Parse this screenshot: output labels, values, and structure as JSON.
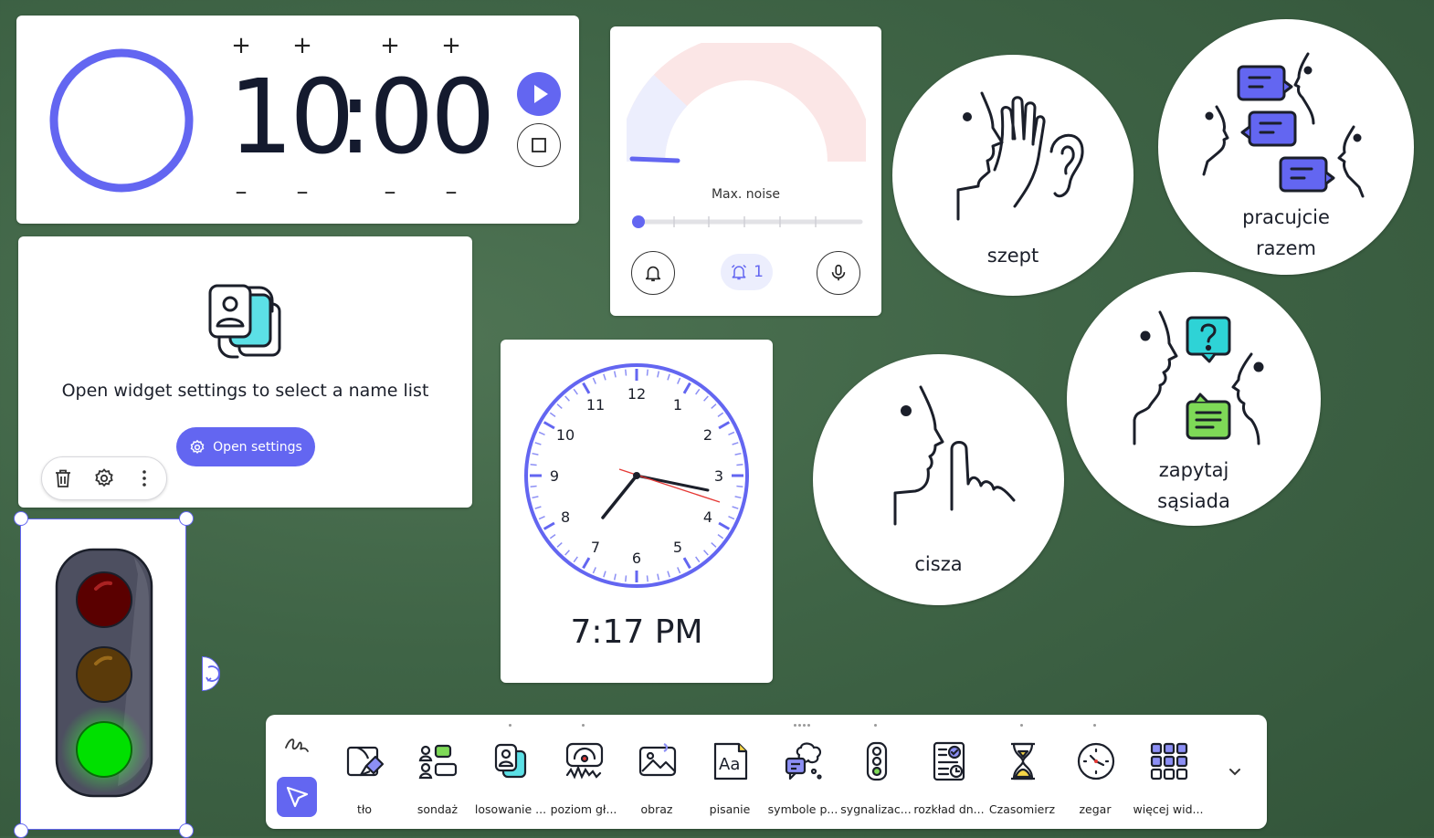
{
  "timer": {
    "minutes": "10",
    "sep": ":",
    "seconds": "00",
    "plus": "+",
    "minus": "–"
  },
  "noise": {
    "label": "Max. noise",
    "alert_count": "1",
    "colors": {
      "accent": "#6366f1",
      "arc_bg": "#fbe6e6",
      "arc_fill": "#eceefd"
    }
  },
  "symbols": {
    "szept": "szept",
    "pracujcie_1": "pracujcie",
    "pracujcie_2": "razem",
    "zapytaj_1": "zapytaj",
    "zapytaj_2": "sąsiada",
    "cisza": "cisza"
  },
  "namelist": {
    "message": "Open widget settings to select a name list",
    "button": "Open settings"
  },
  "clock": {
    "numbers": [
      "12",
      "1",
      "2",
      "3",
      "4",
      "5",
      "6",
      "7",
      "8",
      "9",
      "10",
      "11"
    ],
    "digital": "7:17 PM"
  },
  "traffic_light": {
    "active": "green"
  },
  "toolbar": {
    "items": [
      {
        "label": "tło",
        "icon": "background-icon"
      },
      {
        "label": "sondaż",
        "icon": "poll-icon"
      },
      {
        "label": "losowanie ...",
        "icon": "random-name-icon"
      },
      {
        "label": "poziom gł...",
        "icon": "noise-level-icon"
      },
      {
        "label": "obraz",
        "icon": "image-icon"
      },
      {
        "label": "pisanie",
        "icon": "text-icon"
      },
      {
        "label": "symbole p...",
        "icon": "symbols-icon"
      },
      {
        "label": "sygnalizac...",
        "icon": "traffic-light-icon"
      },
      {
        "label": "rozkład dn...",
        "icon": "schedule-icon"
      },
      {
        "label": "Czasomierz",
        "icon": "hourglass-icon"
      },
      {
        "label": "zegar",
        "icon": "clock-icon"
      },
      {
        "label": "więcej wid...",
        "icon": "more-widgets-icon"
      }
    ]
  }
}
